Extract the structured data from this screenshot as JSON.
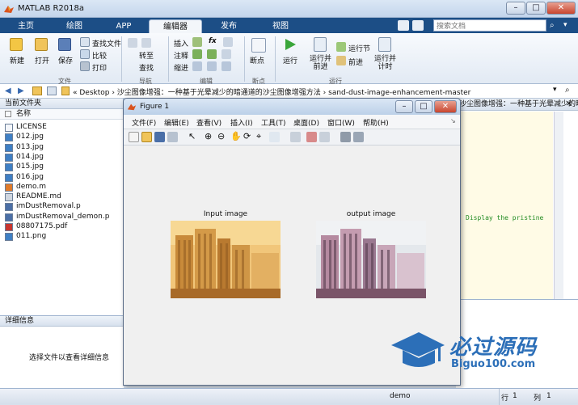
{
  "window": {
    "title": "MATLAB R2018a"
  },
  "tabs": [
    "主页",
    "绘图",
    "APP",
    "编辑器",
    "发布",
    "视图"
  ],
  "active_tab": "编辑器",
  "search": {
    "placeholder": "搜索文档"
  },
  "ribbon": {
    "file_group": {
      "label": "文件",
      "new": "新建",
      "open": "打开",
      "save": "保存",
      "find_files": "查找文件",
      "compare": "比较",
      "print": "打印"
    },
    "nav_group": {
      "label": "导航",
      "goto": "转至",
      "find": "查找"
    },
    "edit_group": {
      "label": "编辑",
      "insert": "插入",
      "comment": "注释",
      "indent": "缩进",
      "fx": "fx"
    },
    "breakpoint_group": {
      "label": "断点",
      "breakpoints": "断点"
    },
    "run_group": {
      "label": "运行",
      "run": "运行",
      "run_advance": "运行并\n前进",
      "run_section": "运行节",
      "advance": "前进",
      "run_time": "运行并\n计时"
    }
  },
  "address": {
    "path": "« Desktop › 沙尘图像增强：一种基于光晕减少的暗通道的沙尘图像增强方法 › sand-dust-image-enhancement-master"
  },
  "current_folder": {
    "title": "当前文件夹",
    "column": "名称",
    "files": [
      "LICENSE",
      "012.jpg",
      "013.jpg",
      "014.jpg",
      "015.jpg",
      "016.jpg",
      "demo.m",
      "README.md",
      "imDustRemoval.p",
      "imDustRemoval_demon.p",
      "08807175.pdf",
      "011.png"
    ]
  },
  "details": {
    "title": "详细信息",
    "hint": "选择文件以查看详细信息"
  },
  "editor": {
    "tab_title": "沙尘图像增强：一种基于光晕减少的暗通道的沙尘图像增...",
    "code_snippet": "Display the pristine"
  },
  "figure": {
    "title": "Figure 1",
    "menus": [
      "文件(F)",
      "编辑(E)",
      "查看(V)",
      "插入(I)",
      "工具(T)",
      "桌面(D)",
      "窗口(W)",
      "帮助(H)"
    ],
    "axes": [
      {
        "title": "Input image"
      },
      {
        "title": "output image"
      }
    ]
  },
  "statusbar": {
    "file": "demo",
    "row_label": "行",
    "row": "1",
    "col_label": "列",
    "col": "1"
  },
  "watermark": {
    "name": "必过源码",
    "url": "Biguo100.com"
  },
  "colors": {
    "tabbar": "#1c4e86",
    "accent": "#2c6fb8",
    "sand": "#d99a3c"
  }
}
